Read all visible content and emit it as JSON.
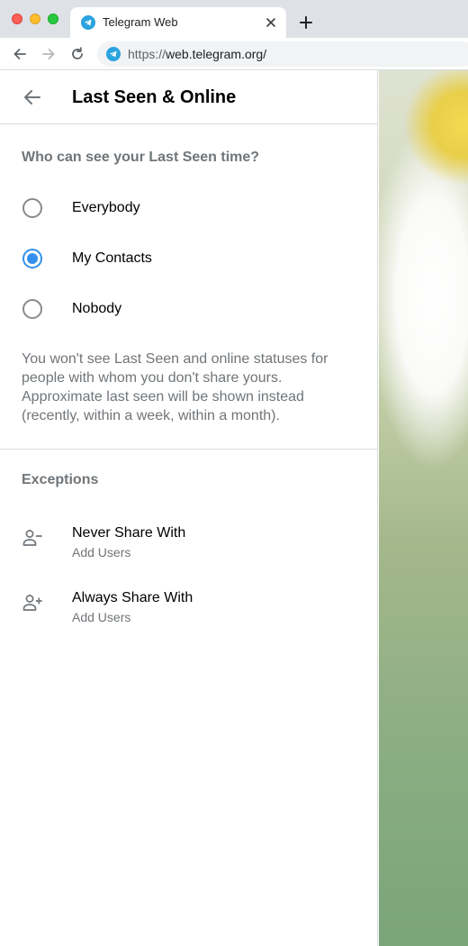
{
  "browser": {
    "tab_title": "Telegram Web",
    "url_scheme": "https://",
    "url_host": "web.telegram.org/",
    "accent": "#3390ec"
  },
  "header": {
    "title": "Last Seen & Online"
  },
  "visibility": {
    "question": "Who can see your Last Seen time?",
    "options": [
      {
        "label": "Everybody",
        "checked": false
      },
      {
        "label": "My Contacts",
        "checked": true
      },
      {
        "label": "Nobody",
        "checked": false
      }
    ],
    "note": "You won't see Last Seen and online statuses for people with whom you don't share yours. Approximate last seen will be shown instead (recently, within a week, within a month)."
  },
  "exceptions": {
    "title": "Exceptions",
    "items": [
      {
        "title": "Never Share With",
        "subtitle": "Add Users",
        "icon": "remove-user-icon"
      },
      {
        "title": "Always Share With",
        "subtitle": "Add Users",
        "icon": "add-user-icon"
      }
    ]
  }
}
